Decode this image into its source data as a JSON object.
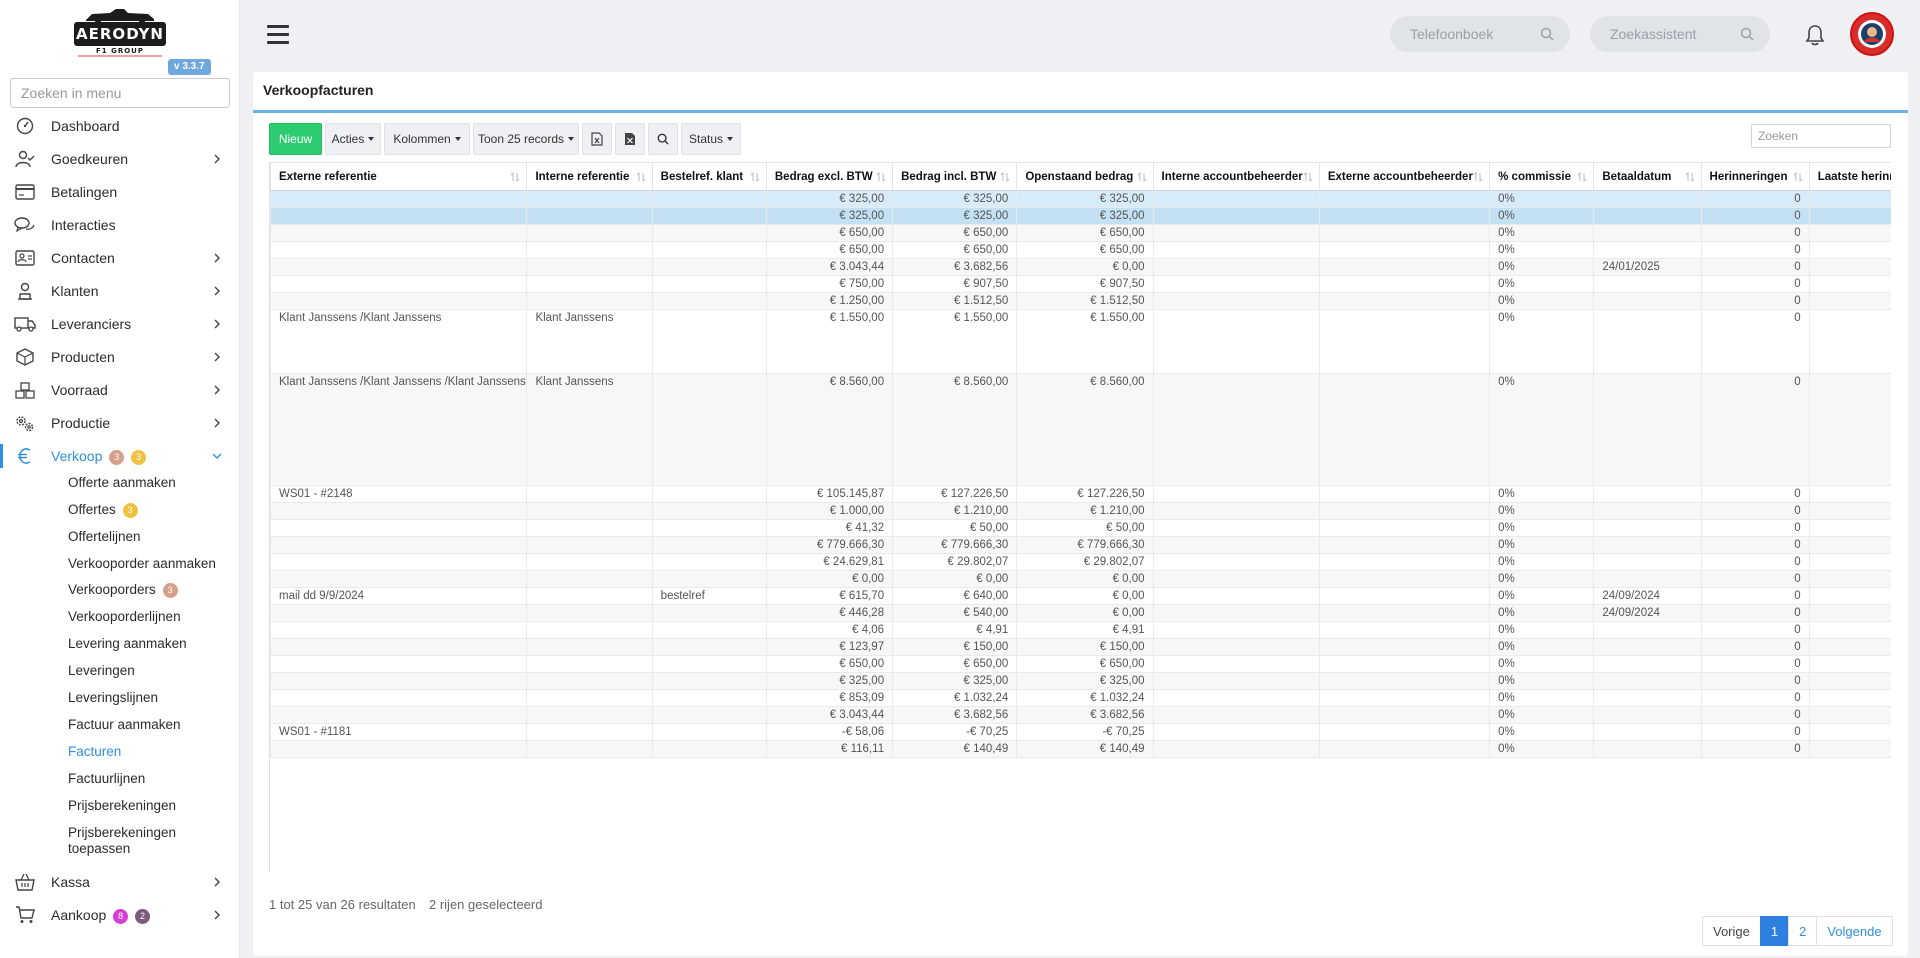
{
  "app": {
    "logo_text": "AERODYN",
    "logo_sub": "F1 GROUP",
    "version": "v 3.3.7"
  },
  "sidebar": {
    "search_placeholder": "Zoeken in menu",
    "items": [
      {
        "label": "Dashboard",
        "icon": "dashboard-icon"
      },
      {
        "label": "Goedkeuren",
        "icon": "user-check-icon"
      },
      {
        "label": "Betalingen",
        "icon": "credit-card-icon"
      },
      {
        "label": "Interacties",
        "icon": "chat-icon"
      },
      {
        "label": "Contacten",
        "icon": "contact-card-icon"
      },
      {
        "label": "Klanten",
        "icon": "customer-icon"
      },
      {
        "label": "Leveranciers",
        "icon": "truck-icon"
      },
      {
        "label": "Producten",
        "icon": "box-icon"
      },
      {
        "label": "Voorraad",
        "icon": "stock-icon"
      },
      {
        "label": "Productie",
        "icon": "gears-icon"
      },
      {
        "label": "Verkoop",
        "icon": "euro-icon",
        "badge1": "3",
        "badge2": "3"
      },
      {
        "label": "Kassa",
        "icon": "basket-icon"
      },
      {
        "label": "Aankoop",
        "icon": "cart-icon",
        "badge1": "8",
        "badge2": "2"
      }
    ],
    "verkoop_sub": [
      {
        "label": "Offerte aanmaken"
      },
      {
        "label": "Offertes",
        "badge": "3"
      },
      {
        "label": "Offertelijnen"
      },
      {
        "label": "Verkooporder aanmaken"
      },
      {
        "label": "Verkooporders",
        "badge": "3"
      },
      {
        "label": "Verkooporderlijnen"
      },
      {
        "label": "Levering aanmaken"
      },
      {
        "label": "Leveringen"
      },
      {
        "label": "Leveringslijnen"
      },
      {
        "label": "Factuur aanmaken"
      },
      {
        "label": "Facturen"
      },
      {
        "label": "Factuurlijnen"
      },
      {
        "label": "Prijsberekeningen"
      },
      {
        "label": "Prijsberekeningen toepassen"
      }
    ]
  },
  "topbar": {
    "phonebook_placeholder": "Telefoonboek",
    "assistant_placeholder": "Zoekassistent"
  },
  "card": {
    "title": "Verkoopfacturen",
    "toolbar": {
      "new": "Nieuw",
      "actions": "Acties",
      "columns": "Kolommen",
      "show": "Toon 25 records",
      "status": "Status",
      "search_placeholder": "Zoeken"
    }
  },
  "table": {
    "columns": [
      "Externe referentie",
      "Interne referentie",
      "Bestelref. klant",
      "Bedrag excl. BTW",
      "Bedrag incl. BTW",
      "Openstaand bedrag",
      "Interne accountbeheerder",
      "Externe accountbeheerder",
      "% commissie",
      "Betaaldatum",
      "Herinneringen",
      "Laatste herinnering"
    ],
    "rows": [
      [
        "",
        "",
        "",
        "€ 325,00",
        "€ 325,00",
        "€ 325,00",
        "",
        "",
        "0%",
        "",
        "0",
        ""
      ],
      [
        "",
        "",
        "",
        "€ 325,00",
        "€ 325,00",
        "€ 325,00",
        "",
        "",
        "0%",
        "",
        "0",
        ""
      ],
      [
        "",
        "",
        "",
        "€ 650,00",
        "€ 650,00",
        "€ 650,00",
        "",
        "",
        "0%",
        "",
        "0",
        ""
      ],
      [
        "",
        "",
        "",
        "€ 650,00",
        "€ 650,00",
        "€ 650,00",
        "",
        "",
        "0%",
        "",
        "0",
        ""
      ],
      [
        "",
        "",
        "",
        "€ 3.043,44",
        "€ 3.682,56",
        "€ 0,00",
        "",
        "",
        "0%",
        "24/01/2025",
        "0",
        ""
      ],
      [
        "",
        "",
        "",
        "€ 750,00",
        "€ 907,50",
        "€ 907,50",
        "",
        "",
        "0%",
        "",
        "0",
        ""
      ],
      [
        "",
        "",
        "",
        "€ 1.250,00",
        "€ 1.512,50",
        "€ 1.512,50",
        "",
        "",
        "0%",
        "",
        "0",
        ""
      ],
      [
        "Klant Janssens /Klant Janssens",
        "Klant Janssens",
        "",
        "€ 1.550,00",
        "€ 1.550,00",
        "€ 1.550,00",
        "",
        "",
        "0%",
        "",
        "0",
        ""
      ],
      [
        "Klant Janssens /Klant Janssens /Klant Janssens",
        "Klant Janssens",
        "",
        "€ 8.560,00",
        "€ 8.560,00",
        "€ 8.560,00",
        "",
        "",
        "0%",
        "",
        "0",
        ""
      ],
      [
        "WS01 - #2148",
        "",
        "",
        "€ 105.145,87",
        "€ 127.226,50",
        "€ 127.226,50",
        "",
        "",
        "0%",
        "",
        "0",
        ""
      ],
      [
        "",
        "",
        "",
        "€ 1.000,00",
        "€ 1.210,00",
        "€ 1.210,00",
        "",
        "",
        "0%",
        "",
        "0",
        ""
      ],
      [
        "",
        "",
        "",
        "€ 41,32",
        "€ 50,00",
        "€ 50,00",
        "",
        "",
        "0%",
        "",
        "0",
        ""
      ],
      [
        "",
        "",
        "",
        "€ 779.666,30",
        "€ 779.666,30",
        "€ 779.666,30",
        "",
        "",
        "0%",
        "",
        "0",
        ""
      ],
      [
        "",
        "",
        "",
        "€ 24.629,81",
        "€ 29.802,07",
        "€ 29.802,07",
        "",
        "",
        "0%",
        "",
        "0",
        ""
      ],
      [
        "",
        "",
        "",
        "€ 0,00",
        "€ 0,00",
        "€ 0,00",
        "",
        "",
        "0%",
        "",
        "0",
        ""
      ],
      [
        "mail dd 9/9/2024",
        "",
        "bestelref",
        "€ 615,70",
        "€ 640,00",
        "€ 0,00",
        "",
        "",
        "0%",
        "24/09/2024",
        "0",
        ""
      ],
      [
        "",
        "",
        "",
        "€ 446,28",
        "€ 540,00",
        "€ 0,00",
        "",
        "",
        "0%",
        "24/09/2024",
        "0",
        ""
      ],
      [
        "",
        "",
        "",
        "€ 4,06",
        "€ 4,91",
        "€ 4,91",
        "",
        "",
        "0%",
        "",
        "0",
        ""
      ],
      [
        "",
        "",
        "",
        "€ 123,97",
        "€ 150,00",
        "€ 150,00",
        "",
        "",
        "0%",
        "",
        "0",
        ""
      ],
      [
        "",
        "",
        "",
        "€ 650,00",
        "€ 650,00",
        "€ 650,00",
        "",
        "",
        "0%",
        "",
        "0",
        ""
      ],
      [
        "",
        "",
        "",
        "€ 325,00",
        "€ 325,00",
        "€ 325,00",
        "",
        "",
        "0%",
        "",
        "0",
        ""
      ],
      [
        "",
        "",
        "",
        "€ 853,09",
        "€ 1.032,24",
        "€ 1.032,24",
        "",
        "",
        "0%",
        "",
        "0",
        ""
      ],
      [
        "",
        "",
        "",
        "€ 3.043,44",
        "€ 3.682,56",
        "€ 3.682,56",
        "",
        "",
        "0%",
        "",
        "0",
        ""
      ],
      [
        "WS01 - #1181",
        "",
        "",
        "-€ 58,06",
        "-€ 70,25",
        "-€ 70,25",
        "",
        "",
        "0%",
        "",
        "0",
        ""
      ],
      [
        "",
        "",
        "",
        "€ 116,11",
        "€ 140,49",
        "€ 140,49",
        "",
        "",
        "0%",
        "",
        "0",
        ""
      ]
    ]
  },
  "footer": {
    "info": "1 tot 25 van 26 resultaten",
    "selected": "2 rijen geselecteerd",
    "pager": {
      "prev": "Vorige",
      "p1": "1",
      "p2": "2",
      "next": "Volgende"
    }
  },
  "colors": {
    "accent": "#2f8fe0",
    "new_button": "#2ecc71",
    "selected_row_1": "#d7ebf8",
    "selected_row_2": "#c4e0f3"
  }
}
